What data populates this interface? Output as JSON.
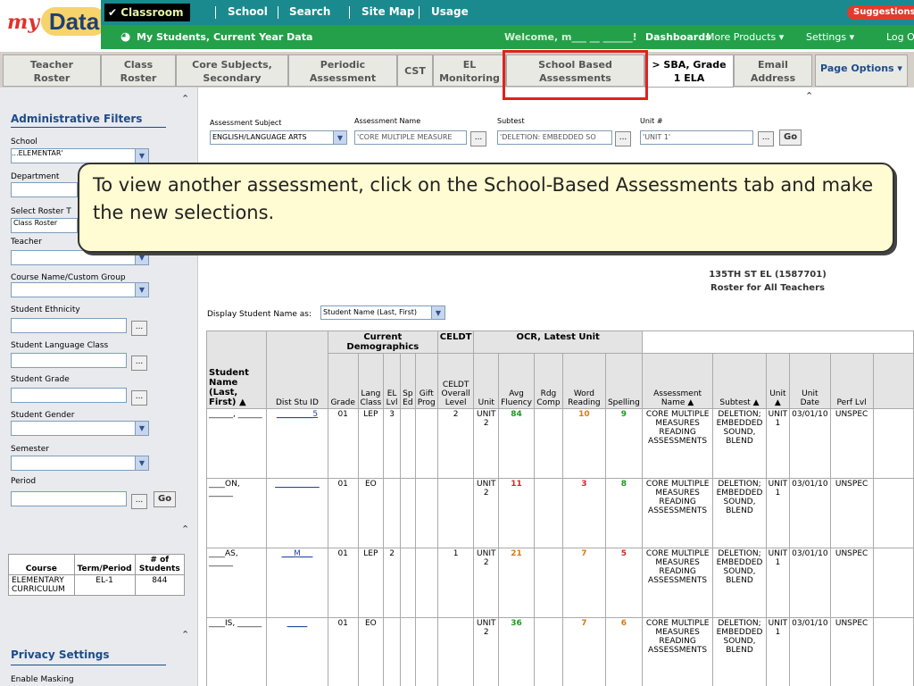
{
  "logo": {
    "my": "my",
    "data": "Data"
  },
  "top_nav": {
    "classroom": "Classroom",
    "school": "School",
    "search": "Search",
    "site_map": "Site Map",
    "usage": "Usage",
    "suggestions": "Suggestions"
  },
  "sub_nav": {
    "page_title": "My Students, Current Year Data",
    "welcome": "Welcome, m___ __ ______!",
    "dashboards": "Dashboards",
    "more_products": "More Products ▾",
    "settings": "Settings ▾",
    "logout": "Log Out"
  },
  "tabs": [
    {
      "l1": "Teacher",
      "l2": "Roster"
    },
    {
      "l1": "Class",
      "l2": "Roster"
    },
    {
      "l1": "Core Subjects,",
      "l2": "Secondary"
    },
    {
      "l1": "Periodic",
      "l2": "Assessment"
    },
    {
      "l1": "CST",
      "l2": ""
    },
    {
      "l1": "EL",
      "l2": "Monitoring"
    },
    {
      "l1": "School Based",
      "l2": "Assessments"
    },
    {
      "l1": "> SBA, Grade",
      "l2": "1 ELA"
    },
    {
      "l1": "Email",
      "l2": "Address"
    }
  ],
  "page_options": "Page Options ▾",
  "admin_filters": {
    "title": "Administrative Filters",
    "school_label": "School",
    "school_value": "...ELEMENTAR'",
    "department_label": "Department",
    "roster_type_label": "Select Roster T",
    "roster_type_value": "Class Roster",
    "teacher_label": "Teacher",
    "course_label": "Course Name/Custom Group",
    "ethnicity_label": "Student Ethnicity",
    "language_label": "Student Language Class",
    "grade_label": "Student Grade",
    "gender_label": "Student Gender",
    "semester_label": "Semester",
    "period_label": "Period",
    "go": "Go"
  },
  "course_table": {
    "headers": [
      "Course",
      "Term/Period",
      "# of Students"
    ],
    "rows": [
      [
        "ELEMENTARY CURRICULUM",
        "EL-1",
        "844"
      ]
    ]
  },
  "privacy": {
    "title": "Privacy Settings",
    "masking": "Enable Masking"
  },
  "assessment_filters": {
    "subject_label": "Assessment Subject",
    "subject_value": "ENGLISH/LANGUAGE ARTS",
    "name_label": "Assessment Name",
    "name_value": "'CORE MULTIPLE MEASURE",
    "subtest_label": "Subtest",
    "subtest_value": "'DELETION: EMBEDDED SO",
    "unit_label": "Unit #",
    "unit_value": "'UNIT 1'",
    "go": "Go"
  },
  "callout": "To view another assessment, click on the School-Based Assessments tab and make the new selections.",
  "roster_info": {
    "line1": "135TH ST EL (1587701)",
    "line2": "Roster for All Teachers"
  },
  "display_name": {
    "label": "Display Student Name as:",
    "value": "Student Name (Last, First)"
  },
  "grid": {
    "groups": [
      "Current Demographics",
      "CELDT",
      "OCR, Latest Unit"
    ],
    "headers": [
      "Student Name (Last, First) ▲",
      "Dist Stu ID",
      "Grade",
      "Lang Class",
      "EL Lvl",
      "Sp Ed",
      "Gift Prog",
      "CELDT Overall Level",
      "Unit",
      "Avg Fluency",
      "Rdg Comp",
      "Word Reading",
      "Spelling",
      "Assessment Name ▲",
      "Subtest ▲",
      "Unit ▲",
      "Unit Date",
      "Perf Lvl"
    ],
    "rows": [
      {
        "name": "______, ______",
        "id": "_________5",
        "grade": "01",
        "lang": "LEP",
        "el": "3",
        "celdt": "2",
        "unit": "UNIT 2",
        "fluency": "84",
        "fl_c": "g",
        "word": "10",
        "w_c": "o",
        "spell": "9",
        "s_c": "g"
      },
      {
        "name": "____ON, ______",
        "id": "___________",
        "grade": "01",
        "lang": "EO",
        "el": "",
        "celdt": "",
        "unit": "UNIT 2",
        "fluency": "11",
        "fl_c": "r",
        "word": "3",
        "w_c": "r",
        "spell": "8",
        "s_c": "g"
      },
      {
        "name": "____AS, ______",
        "id": "___M___",
        "grade": "01",
        "lang": "LEP",
        "el": "2",
        "celdt": "1",
        "unit": "UNIT 2",
        "fluency": "21",
        "fl_c": "o",
        "word": "7",
        "w_c": "o",
        "spell": "5",
        "s_c": "r"
      },
      {
        "name": "____IS, ______",
        "id": "_____",
        "grade": "01",
        "lang": "EO",
        "el": "",
        "celdt": "",
        "unit": "UNIT 2",
        "fluency": "36",
        "fl_c": "g",
        "word": "7",
        "w_c": "o",
        "spell": "6",
        "s_c": "o"
      }
    ],
    "assessment": "CORE MULTIPLE MEASURES READING ASSESSMENTS",
    "subtest": "DELETION; EMBEDDED SOUND, BLEND",
    "unit_col": "UNIT 1",
    "date": "03/01/10",
    "perf": "UNSPEC"
  }
}
